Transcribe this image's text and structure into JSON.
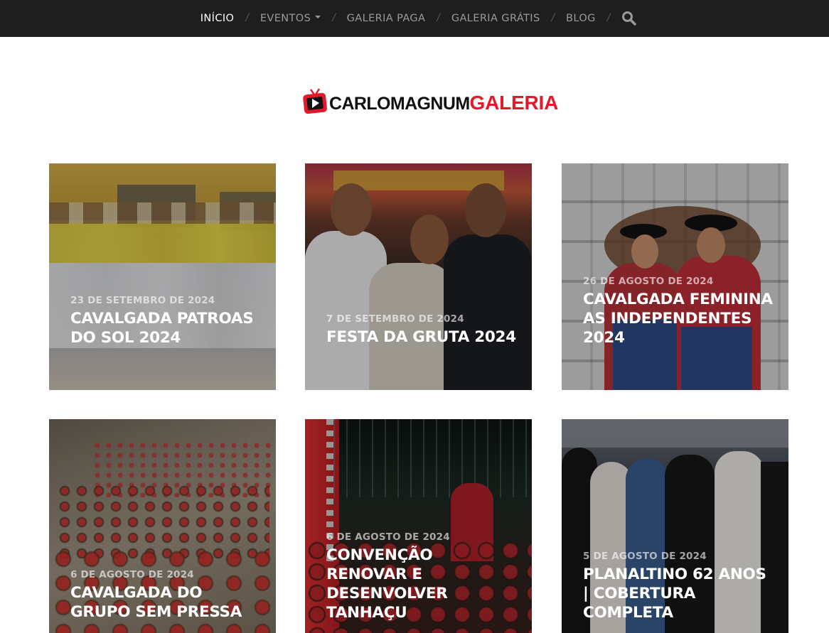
{
  "nav": {
    "items": [
      {
        "label": "INÍCIO",
        "active": true
      },
      {
        "label": "EVENTOS",
        "dropdown": true
      },
      {
        "label": "GALERIA PAGA"
      },
      {
        "label": "GALERIA GRÁTIS"
      },
      {
        "label": "BLOG"
      }
    ],
    "separator": "/",
    "search_icon": "search-icon"
  },
  "logo": {
    "part1": "CARLOMAGNUM",
    "part2": "GALERIA",
    "icon": "tv-play-icon",
    "brand_color": "#e3192a"
  },
  "posts": [
    {
      "date": "23 DE SETEMBRO DE 2024",
      "title": "CAVALGADA PATROAS DO SOL 2024"
    },
    {
      "date": "7 DE SETEMBRO DE 2024",
      "title": "FESTA DA GRUTA 2024"
    },
    {
      "date": "26 DE AGOSTO DE 2024",
      "title": "CAVALGADA FEMININA AS INDEPENDENTES 2024"
    },
    {
      "date": "6 DE AGOSTO DE 2024",
      "title": "CAVALGADA DO GRUPO SEM PRESSA"
    },
    {
      "date": "6 DE AGOSTO DE 2024",
      "title": "CONVENÇÃO RENOVAR E DESENVOLVER TANHAÇU"
    },
    {
      "date": "5 DE AGOSTO DE 2024",
      "title": "PLANALTINO 62 ANOS | COBERTURA COMPLETA"
    }
  ],
  "colors": {
    "nav_bg": "#1e1e1e",
    "nav_text": "#9a9a9a",
    "nav_active": "#ffffff"
  }
}
